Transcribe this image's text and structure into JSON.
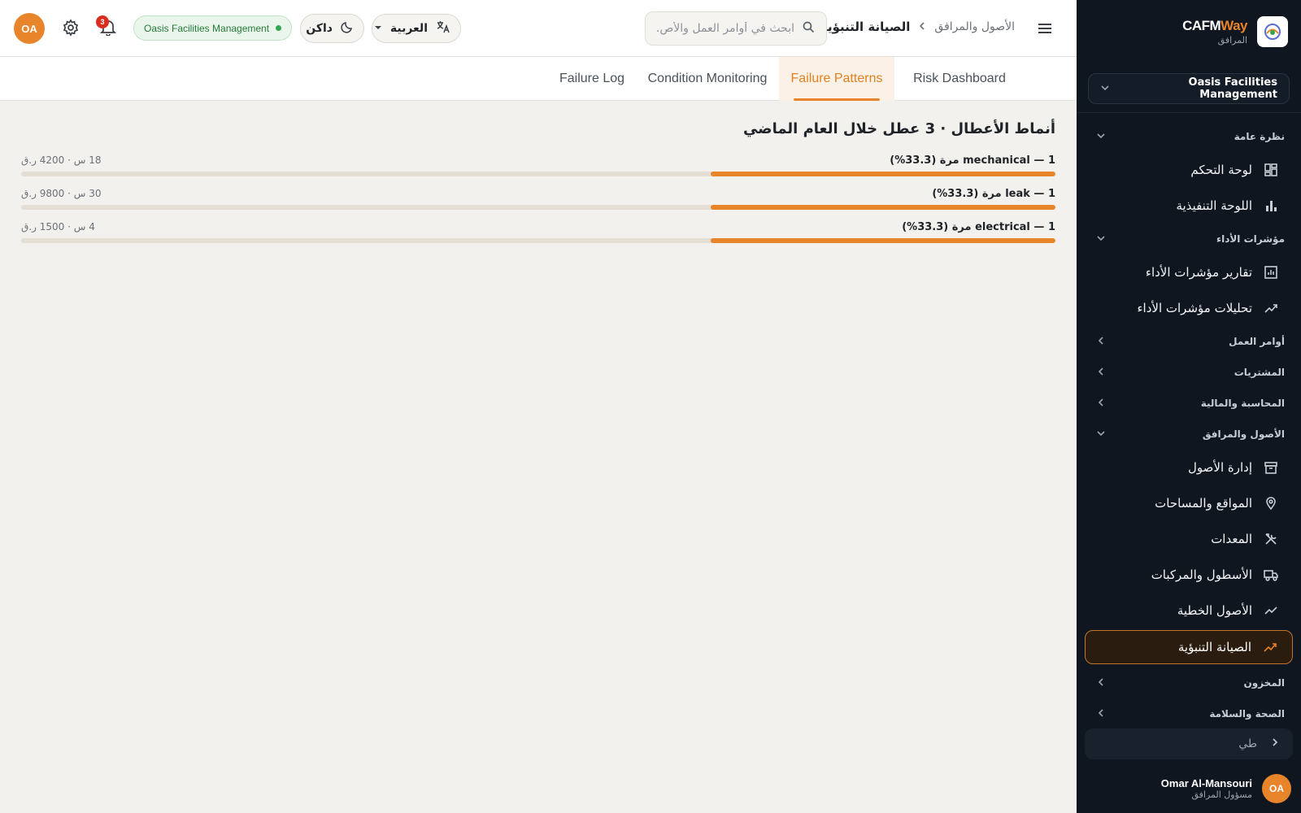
{
  "colors": {
    "accent": "#e8842a",
    "sidebar_bg": "#0f1620",
    "status_green": "#2fa84f",
    "badge_red": "#d92d20"
  },
  "sidebar": {
    "brand_name_a": "CAFM",
    "brand_name_b": "Way",
    "brand_sub": "المرافق",
    "org_select": "Oasis Facilities Management",
    "sections": {
      "overview": "نظرة عامة",
      "kpis": "مؤشرات الأداء",
      "work_orders": "أوامر العمل",
      "procurement": "المشتريات",
      "accounting": "المحاسبة والمالية",
      "assets": "الأصول والمرافق",
      "inventory": "المخزون",
      "hse": "الصحة والسلامة"
    },
    "items": {
      "dashboard": "لوحة التحكم",
      "executive": "اللوحة التنفيذية",
      "kpi_reports": "تقارير مؤشرات الأداء",
      "kpi_analytics": "تحليلات مؤشرات الأداء",
      "asset_mgmt": "إدارة الأصول",
      "locations": "المواقع والمساحات",
      "equipment": "المعدات",
      "fleet": "الأسطول والمركبات",
      "linear_assets": "الأصول الخطية",
      "predictive": "الصيانة التنبؤية"
    },
    "collapse_label": "طي",
    "user": {
      "initials": "OA",
      "name": "Omar Al-Mansouri",
      "role": "مسؤول المرافق"
    }
  },
  "header": {
    "breadcrumb_parent": "الأصول والمرافق",
    "breadcrumb_current": "الصيانة التنبؤية",
    "search_placeholder": "ابحث في أوامر العمل والأص...",
    "language": "العربية",
    "theme": "داكن",
    "org_status": "Oasis Facilities Management",
    "notifications_count": "3",
    "avatar_initials": "OA"
  },
  "tabs": [
    {
      "label": "Risk Dashboard",
      "active": false
    },
    {
      "label": "Failure Patterns",
      "active": true
    },
    {
      "label": "Condition Monitoring",
      "active": false
    },
    {
      "label": "Failure Log",
      "active": false
    }
  ],
  "failure_patterns": {
    "title": "أنماط الأعطال · 3 عطل خلال العام الماضي",
    "rows": [
      {
        "label": "1 — mechanical مرة (33.3%)",
        "meta": "18 س · 4200 ر.ق",
        "share": 0.333
      },
      {
        "label": "1 — leak مرة (33.3%)",
        "meta": "30 س · 9800 ر.ق",
        "share": 0.333
      },
      {
        "label": "1 — electrical مرة (33.3%)",
        "meta": "4 س · 1500 ر.ق",
        "share": 0.333
      }
    ]
  }
}
